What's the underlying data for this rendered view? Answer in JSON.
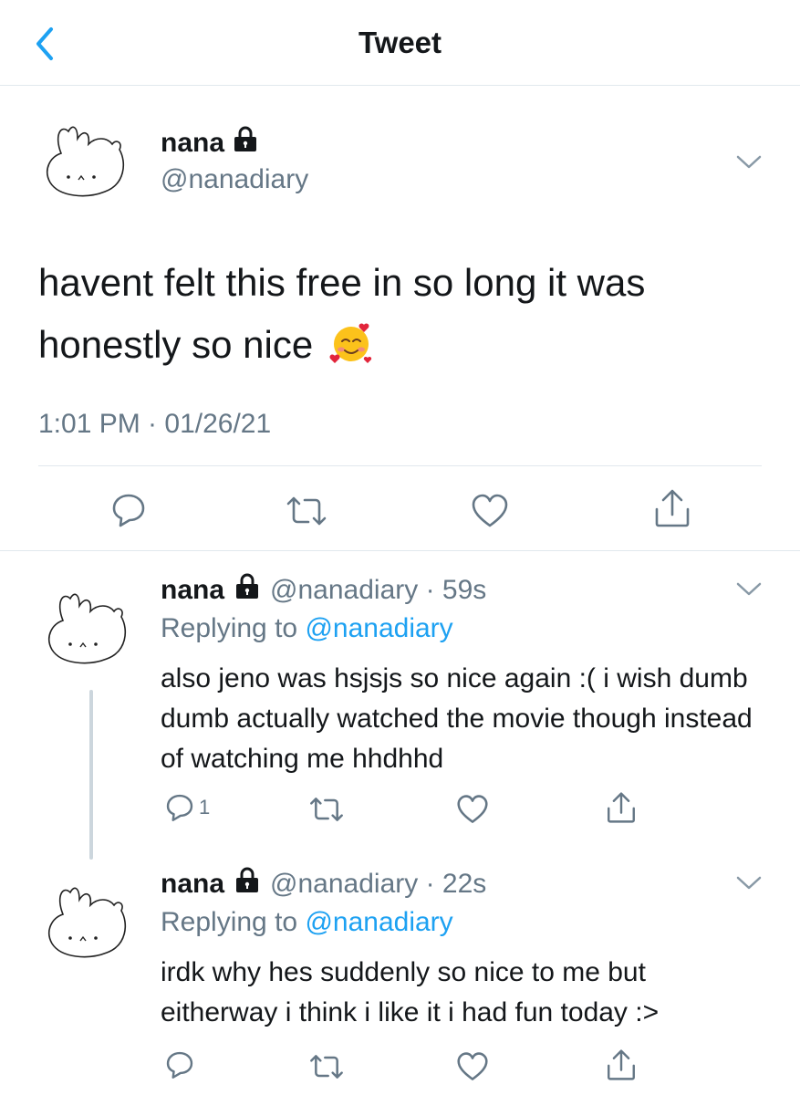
{
  "header": {
    "title": "Tweet"
  },
  "main_tweet": {
    "name": "nana",
    "handle": "@nanadiary",
    "text": "havent felt this free in so long it was honestly so nice",
    "emoji": "smiling-face-with-hearts",
    "timestamp": "1:01 PM · 01/26/21"
  },
  "replies": [
    {
      "name": "nana",
      "handle_time": "@nanadiary · 59s",
      "replying_label": "Replying to",
      "replying_to": "@nanadiary",
      "text": "also jeno was hsjsjs so nice again :( i wish dumb dumb actually watched the movie though instead of watching me hhdhhd",
      "reply_count": "1"
    },
    {
      "name": "nana",
      "handle_time": "@nanadiary · 22s",
      "replying_label": "Replying to",
      "replying_to": "@nanadiary",
      "text": "irdk why hes suddenly so nice to me but eitherway i think i like it i had fun today :>",
      "reply_count": ""
    }
  ],
  "colors": {
    "accent": "#1da1f2",
    "secondary_text": "#657786",
    "divider": "#e1e8ed"
  }
}
